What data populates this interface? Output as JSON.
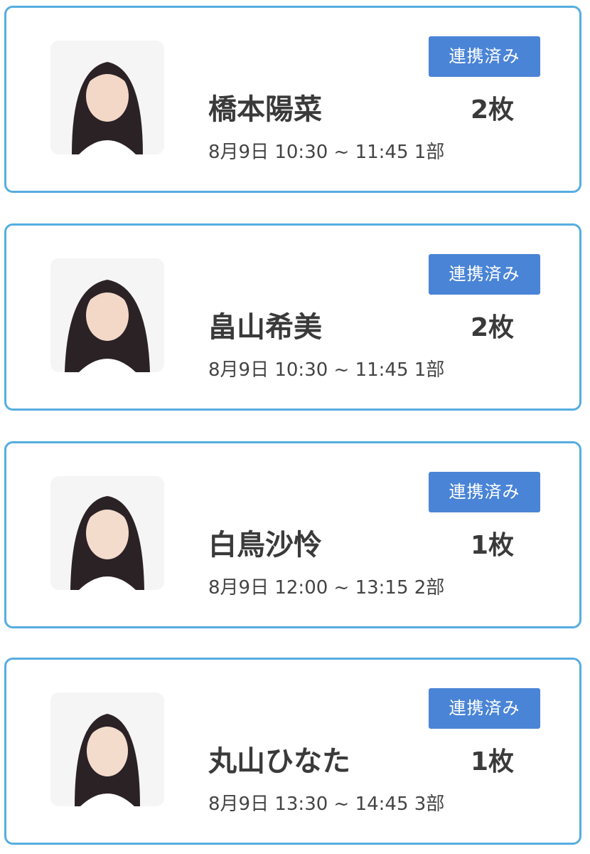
{
  "entries": [
    {
      "name": "橋本陽菜",
      "tickets": "2枚",
      "time": "8月9日 10:30 ~ 11:45 1部",
      "status": "連携済み"
    },
    {
      "name": "畠山希美",
      "tickets": "2枚",
      "time": "8月9日 10:30 ~ 11:45 1部",
      "status": "連携済み"
    },
    {
      "name": "白鳥沙怜",
      "tickets": "1枚",
      "time": "8月9日 12:00 ~ 13:15 2部",
      "status": "連携済み"
    },
    {
      "name": "丸山ひなた",
      "tickets": "1枚",
      "time": "8月9日 13:30 ~ 14:45 3部",
      "status": "連携済み"
    }
  ],
  "colors": {
    "card_border": "#56ade0",
    "badge_background": "#4a84d6",
    "badge_text": "#ffffff"
  },
  "icons": {
    "photo": "member-photo-icon"
  }
}
